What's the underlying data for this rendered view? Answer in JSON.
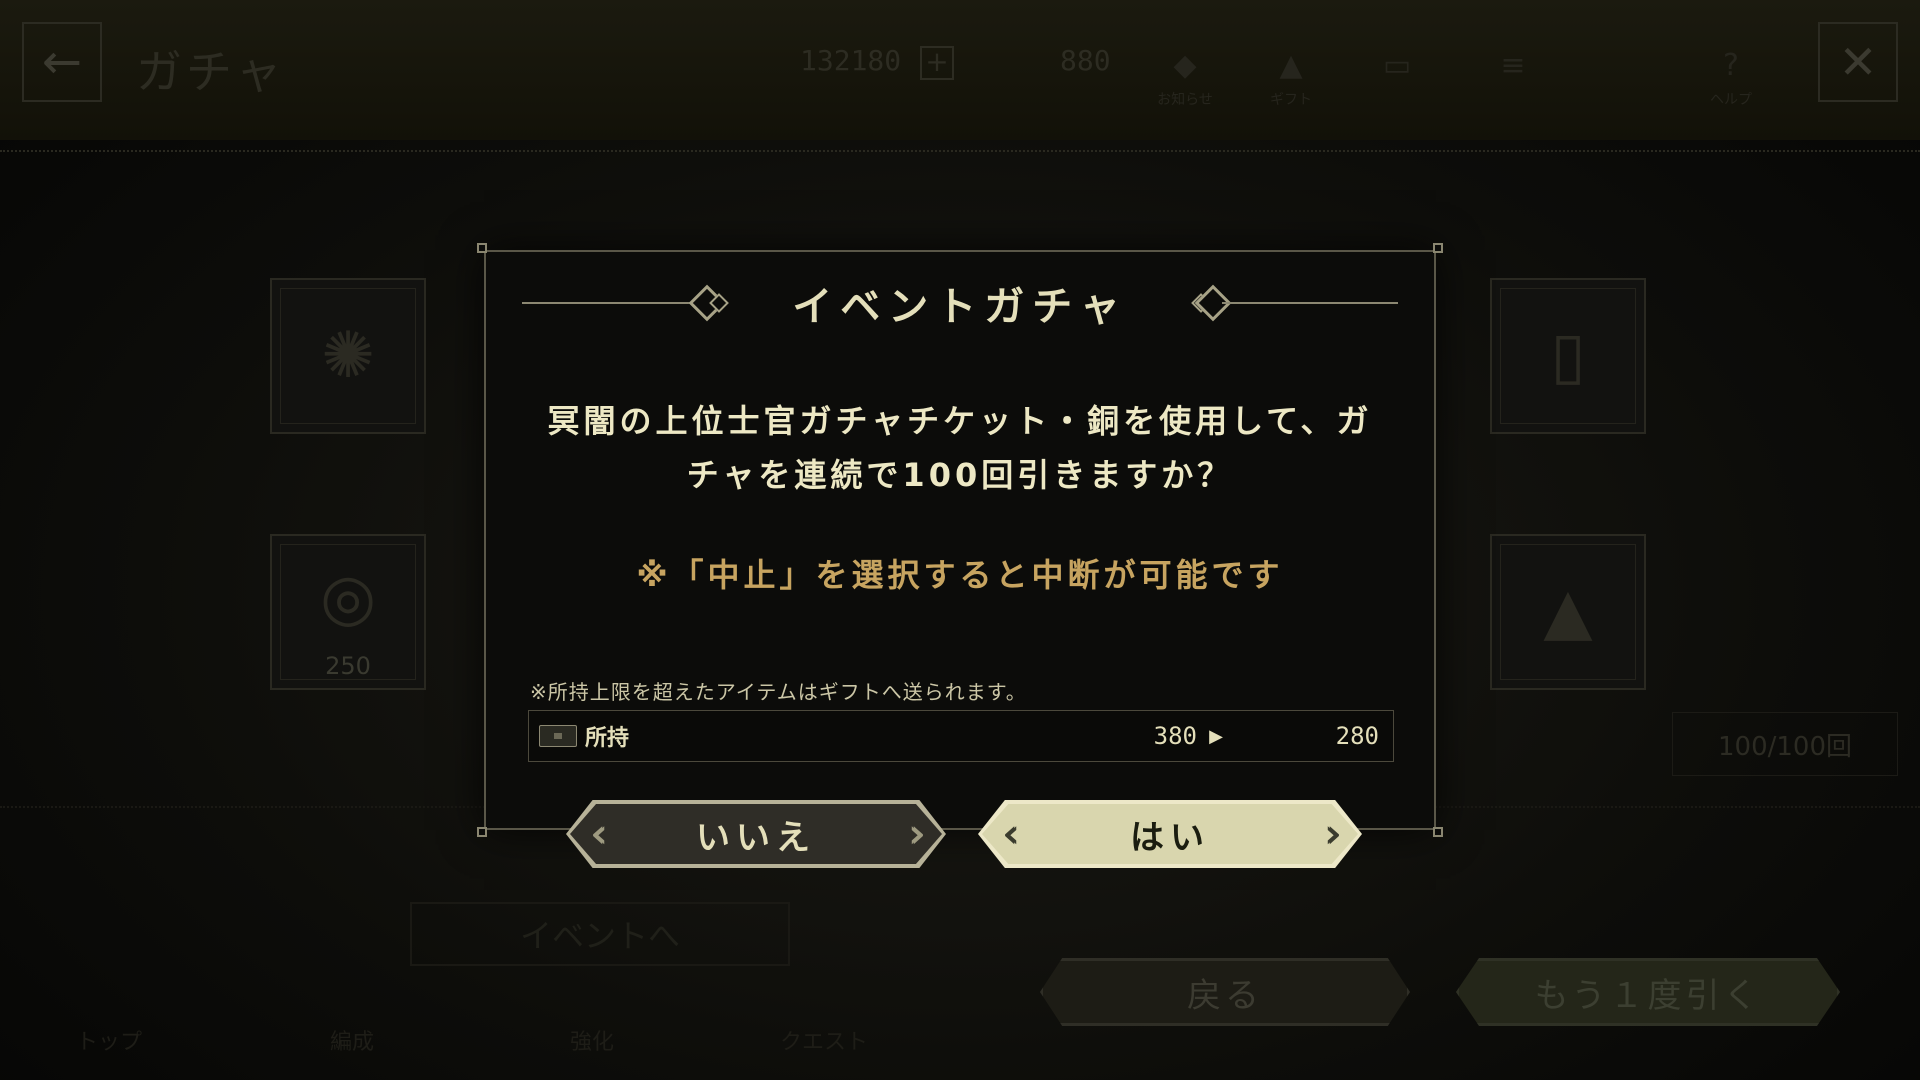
{
  "header": {
    "back_glyph": "←",
    "title": "ガチャ",
    "currency1": "132180",
    "plus_glyph": "+",
    "currency2": "880",
    "close_glyph": "✕",
    "icons": [
      {
        "name": "notice-icon",
        "label": "お知らせ",
        "glyph": "◆"
      },
      {
        "name": "gift-icon",
        "label": "ギフト",
        "glyph": "▲"
      },
      {
        "name": "card-icon",
        "label": "",
        "glyph": "▭"
      },
      {
        "name": "menu-icon",
        "label": "",
        "glyph": "≡"
      },
      {
        "name": "help-icon",
        "label": "ヘルプ",
        "glyph": "?"
      }
    ]
  },
  "background": {
    "side_left_top_glyph": "✺",
    "side_left_bottom_glyph": "◎",
    "side_left_bottom_count": "250",
    "side_right_top_glyph": "▯",
    "side_right_bottom_glyph": "▲",
    "counter": "100/100回",
    "event_button": "イベントへ",
    "back_button": "戻る",
    "again_button": "もう１度引く",
    "nav": [
      "トップ",
      "編成",
      "強化",
      "クエスト"
    ]
  },
  "dialog": {
    "title": "イベントガチャ",
    "message_line1": "冥闇の上位士官ガチャチケット・銅を使用して、ガ",
    "message_line2": "チャを連続で100回引きますか？",
    "note": "※「中止」を選択すると中断が可能です",
    "limit_note": "※所持上限を超えたアイテムはギフトへ送られます。",
    "hold_label": "所持",
    "hold_before": "380",
    "hold_arrow": "▶",
    "hold_after": "280",
    "no_label": "いいえ",
    "yes_label": "はい"
  }
}
